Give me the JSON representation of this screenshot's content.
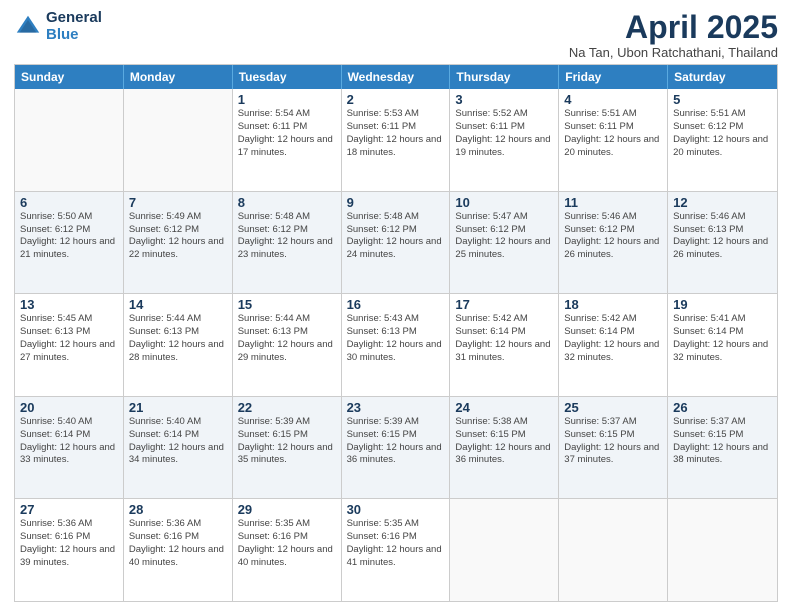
{
  "logo": {
    "general": "General",
    "blue": "Blue"
  },
  "title": "April 2025",
  "subtitle": "Na Tan, Ubon Ratchathani, Thailand",
  "days_of_week": [
    "Sunday",
    "Monday",
    "Tuesday",
    "Wednesday",
    "Thursday",
    "Friday",
    "Saturday"
  ],
  "weeks": [
    [
      {
        "day": "",
        "info": ""
      },
      {
        "day": "",
        "info": ""
      },
      {
        "day": "1",
        "info": "Sunrise: 5:54 AM\nSunset: 6:11 PM\nDaylight: 12 hours and 17 minutes."
      },
      {
        "day": "2",
        "info": "Sunrise: 5:53 AM\nSunset: 6:11 PM\nDaylight: 12 hours and 18 minutes."
      },
      {
        "day": "3",
        "info": "Sunrise: 5:52 AM\nSunset: 6:11 PM\nDaylight: 12 hours and 19 minutes."
      },
      {
        "day": "4",
        "info": "Sunrise: 5:51 AM\nSunset: 6:11 PM\nDaylight: 12 hours and 20 minutes."
      },
      {
        "day": "5",
        "info": "Sunrise: 5:51 AM\nSunset: 6:12 PM\nDaylight: 12 hours and 20 minutes."
      }
    ],
    [
      {
        "day": "6",
        "info": "Sunrise: 5:50 AM\nSunset: 6:12 PM\nDaylight: 12 hours and 21 minutes."
      },
      {
        "day": "7",
        "info": "Sunrise: 5:49 AM\nSunset: 6:12 PM\nDaylight: 12 hours and 22 minutes."
      },
      {
        "day": "8",
        "info": "Sunrise: 5:48 AM\nSunset: 6:12 PM\nDaylight: 12 hours and 23 minutes."
      },
      {
        "day": "9",
        "info": "Sunrise: 5:48 AM\nSunset: 6:12 PM\nDaylight: 12 hours and 24 minutes."
      },
      {
        "day": "10",
        "info": "Sunrise: 5:47 AM\nSunset: 6:12 PM\nDaylight: 12 hours and 25 minutes."
      },
      {
        "day": "11",
        "info": "Sunrise: 5:46 AM\nSunset: 6:12 PM\nDaylight: 12 hours and 26 minutes."
      },
      {
        "day": "12",
        "info": "Sunrise: 5:46 AM\nSunset: 6:13 PM\nDaylight: 12 hours and 26 minutes."
      }
    ],
    [
      {
        "day": "13",
        "info": "Sunrise: 5:45 AM\nSunset: 6:13 PM\nDaylight: 12 hours and 27 minutes."
      },
      {
        "day": "14",
        "info": "Sunrise: 5:44 AM\nSunset: 6:13 PM\nDaylight: 12 hours and 28 minutes."
      },
      {
        "day": "15",
        "info": "Sunrise: 5:44 AM\nSunset: 6:13 PM\nDaylight: 12 hours and 29 minutes."
      },
      {
        "day": "16",
        "info": "Sunrise: 5:43 AM\nSunset: 6:13 PM\nDaylight: 12 hours and 30 minutes."
      },
      {
        "day": "17",
        "info": "Sunrise: 5:42 AM\nSunset: 6:14 PM\nDaylight: 12 hours and 31 minutes."
      },
      {
        "day": "18",
        "info": "Sunrise: 5:42 AM\nSunset: 6:14 PM\nDaylight: 12 hours and 32 minutes."
      },
      {
        "day": "19",
        "info": "Sunrise: 5:41 AM\nSunset: 6:14 PM\nDaylight: 12 hours and 32 minutes."
      }
    ],
    [
      {
        "day": "20",
        "info": "Sunrise: 5:40 AM\nSunset: 6:14 PM\nDaylight: 12 hours and 33 minutes."
      },
      {
        "day": "21",
        "info": "Sunrise: 5:40 AM\nSunset: 6:14 PM\nDaylight: 12 hours and 34 minutes."
      },
      {
        "day": "22",
        "info": "Sunrise: 5:39 AM\nSunset: 6:15 PM\nDaylight: 12 hours and 35 minutes."
      },
      {
        "day": "23",
        "info": "Sunrise: 5:39 AM\nSunset: 6:15 PM\nDaylight: 12 hours and 36 minutes."
      },
      {
        "day": "24",
        "info": "Sunrise: 5:38 AM\nSunset: 6:15 PM\nDaylight: 12 hours and 36 minutes."
      },
      {
        "day": "25",
        "info": "Sunrise: 5:37 AM\nSunset: 6:15 PM\nDaylight: 12 hours and 37 minutes."
      },
      {
        "day": "26",
        "info": "Sunrise: 5:37 AM\nSunset: 6:15 PM\nDaylight: 12 hours and 38 minutes."
      }
    ],
    [
      {
        "day": "27",
        "info": "Sunrise: 5:36 AM\nSunset: 6:16 PM\nDaylight: 12 hours and 39 minutes."
      },
      {
        "day": "28",
        "info": "Sunrise: 5:36 AM\nSunset: 6:16 PM\nDaylight: 12 hours and 40 minutes."
      },
      {
        "day": "29",
        "info": "Sunrise: 5:35 AM\nSunset: 6:16 PM\nDaylight: 12 hours and 40 minutes."
      },
      {
        "day": "30",
        "info": "Sunrise: 5:35 AM\nSunset: 6:16 PM\nDaylight: 12 hours and 41 minutes."
      },
      {
        "day": "",
        "info": ""
      },
      {
        "day": "",
        "info": ""
      },
      {
        "day": "",
        "info": ""
      }
    ]
  ]
}
